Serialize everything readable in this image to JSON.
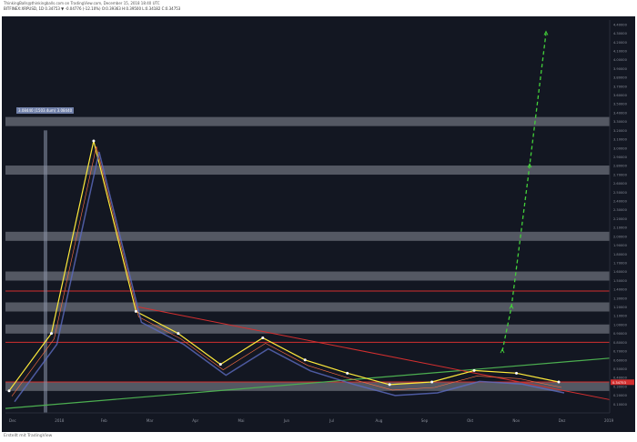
{
  "header": {
    "line1": "ThinkingBalls@thinkingballs.com on TradingView.com, December 15, 2018 18:40 UTC",
    "line2": "BITFINEX:XRPUSD, 1D 0.34753 ▼ -0.04776 (-12.10%) O:0.39363 H:0.39500 L:0.34182 C:0.34753"
  },
  "footer": {
    "note": "Erstellt mit TradingView"
  },
  "high_label": "3.08440 (1503.4um) 3.08440",
  "price_axis": [
    "4.40000",
    "4.30000",
    "4.20000",
    "4.10000",
    "4.00000",
    "3.90000",
    "3.80000",
    "3.70000",
    "3.60000",
    "3.50000",
    "3.40000",
    "3.30000",
    "3.20000",
    "3.10000",
    "3.00000",
    "2.90000",
    "2.80000",
    "2.70000",
    "2.60000",
    "2.50000",
    "2.40000",
    "2.30000",
    "2.20000",
    "2.10000",
    "2.00000",
    "1.90000",
    "1.80000",
    "1.70000",
    "1.60000",
    "1.50000",
    "1.40000",
    "1.30000",
    "1.20000",
    "1.10000",
    "1.00000",
    "0.90000",
    "0.80000",
    "0.70000",
    "0.60000",
    "0.50000",
    "0.40000",
    "0.30000",
    "0.20000",
    "0.10000"
  ],
  "current_price": "0.34753",
  "time_axis": [
    "Dec",
    "2018",
    "Feb",
    "Mar",
    "Apr",
    "Mai",
    "Jun",
    "Jul",
    "Aug",
    "Sep",
    "Okt",
    "Nov",
    "Dez",
    "2019"
  ],
  "colors": {
    "background": "#131722",
    "band": "#6b6f7a",
    "resistance": "#d32f2f",
    "trend_green": "#4caf50",
    "projection": "#43d13a",
    "price_tag": "#6f7fa8"
  },
  "chart_data": {
    "type": "line",
    "title": "",
    "xlabel": "",
    "ylabel": "",
    "ylim": [
      0,
      4.45
    ],
    "series": [
      {
        "name": "",
        "x": [
          "Dec",
          "2018",
          "Jan",
          "Feb",
          "Mar",
          "Apr",
          "Mai",
          "Jun",
          "Jul",
          "Aug",
          "Sep",
          "Okt",
          "Nov",
          "Dez"
        ],
        "values": [
          0.25,
          0.9,
          3.08,
          1.15,
          0.9,
          0.55,
          0.85,
          0.6,
          0.45,
          0.32,
          0.35,
          0.48,
          0.45,
          0.35
        ]
      },
      {
        "name": "",
        "x": [
          "Okt",
          "Nov",
          "Nov",
          "Dez"
        ],
        "values": [
          0.7,
          1.2,
          2.8,
          4.3
        ]
      }
    ],
    "horizontal_zones": [
      3.3,
      2.75,
      2.0,
      1.55,
      1.2,
      0.95,
      0.3
    ],
    "resistance_lines": [
      1.38,
      0.8,
      0.35
    ]
  }
}
